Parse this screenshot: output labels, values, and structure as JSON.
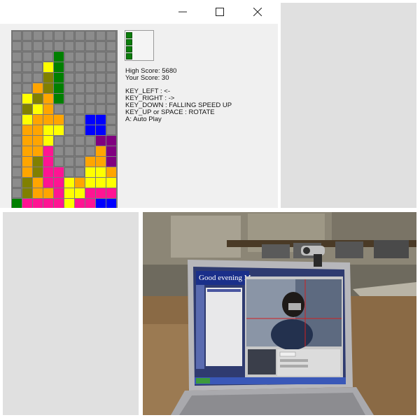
{
  "window": {
    "buttons": {
      "minimize": "—",
      "maximize": "☐",
      "close": "✕"
    }
  },
  "info": {
    "high_score": "High Score: 5680",
    "your_score": "Your Score: 30",
    "controls": [
      "KEY_LEFT : <-",
      "KEY_RIGHT : ->",
      "KEY_DOWN : FALLING SPEED UP",
      "KEY_UP or SPACE : ROTATE",
      "A: Auto Play"
    ]
  },
  "colors": {
    "grid_bg": "#7b7b7b",
    "empty": "#8c8c8c",
    "yellow": "#ffff00",
    "olive": "#808000",
    "green": "#008000",
    "orange": "#ffa500",
    "magenta": "#ff1493",
    "blue": "#0000ff",
    "purple": "#800080",
    "panel_gray": "#e0e0e0"
  },
  "board": {
    "columns": 10,
    "rows": [
      "..........",
      "..........",
      "....G.....",
      "...YG.....",
      "...YG.....",
      "..OYG.....",
      ".YOOG.....",
      ".YYO......",
      ".YOOO..BB.",
      ".OOYY..BB.",
      ".OOY....PP",
      ".OOM....OP",
      ".OOM...OOP",
      ".OOMM..YYO",
      ".OOMMYOYYY",
      ".OOOMYYMMM",
      "GMMMMYMMBB",
      "GOOOMYMYBB"
    ]
  },
  "photo": {
    "screen_title": "Good evening Me"
  }
}
